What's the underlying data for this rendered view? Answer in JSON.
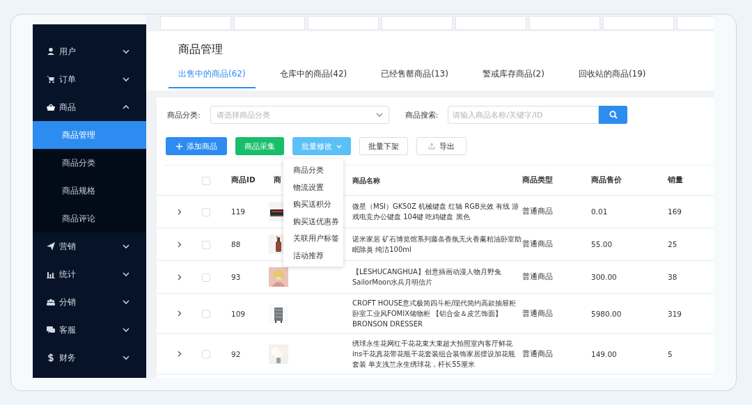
{
  "sidebar": {
    "items": [
      {
        "label": "用户",
        "expanded": false
      },
      {
        "label": "订单",
        "expanded": false
      },
      {
        "label": "商品",
        "expanded": true,
        "children": [
          {
            "label": "商品管理",
            "selected": true
          },
          {
            "label": "商品分类",
            "selected": false
          },
          {
            "label": "商品规格",
            "selected": false
          },
          {
            "label": "商品评论",
            "selected": false
          }
        ]
      },
      {
        "label": "营销",
        "expanded": false
      },
      {
        "label": "统计",
        "expanded": false
      },
      {
        "label": "分销",
        "expanded": false
      },
      {
        "label": "客服",
        "expanded": false
      },
      {
        "label": "财务",
        "expanded": false
      }
    ]
  },
  "page": {
    "title": "商品管理"
  },
  "tabs": [
    {
      "label": "出售中的商品(62)",
      "selected": true
    },
    {
      "label": "仓库中的商品(42)",
      "selected": false
    },
    {
      "label": "已经售罄商品(13)",
      "selected": false
    },
    {
      "label": "警戒库存商品(2)",
      "selected": false
    },
    {
      "label": "回收站的商品(19)",
      "selected": false
    }
  ],
  "filters": {
    "category": {
      "label": "商品分类:",
      "placeholder": "请选择商品分类"
    },
    "search": {
      "label": "商品搜索:",
      "placeholder": "请输入商品名称/关键字/ID"
    }
  },
  "toolbar": [
    {
      "label": "添加商品",
      "kind": "primary"
    },
    {
      "label": "商品采集",
      "kind": "success"
    },
    {
      "label": "批量修改",
      "kind": "menu",
      "expanded": true
    },
    {
      "label": "批量下架",
      "kind": "default"
    },
    {
      "label": "导出",
      "kind": "export"
    }
  ],
  "batch_menu": {
    "items": [
      "商品分类",
      "物流设置",
      "购买送积分",
      "购买送优惠券",
      "关联用户标签",
      "活动推荐"
    ]
  },
  "table": {
    "header_checked": false,
    "columns": [
      "商品ID",
      "商",
      "商品名称",
      "商品类型",
      "商品售价",
      "销量"
    ],
    "rows": [
      {
        "id": "119",
        "name": "微星（MSI）GK50Z 机械键盘 红轴 RGB光效 有线 游戏电竞办公键盘 104键 吃鸡键盘 黑色",
        "type": "普通商品",
        "price": "0.01",
        "sales": "169",
        "checked": false,
        "expanded": false
      },
      {
        "id": "88",
        "name": "诺米家居 矿石博览馆系列藤条香氛无火香薰精油卧室助眠除臭 纯洁100ml",
        "type": "普通商品",
        "price": "55.00",
        "sales": "25",
        "checked": false,
        "expanded": false
      },
      {
        "id": "93",
        "name": "【LESHUCANGHUA】创意插画动漫人物月野兔SailorMoon水兵月明信片",
        "type": "普通商品",
        "price": "300.00",
        "sales": "38",
        "checked": false,
        "expanded": false
      },
      {
        "id": "109",
        "name": "CROFT HOUSE意式极简四斗柜/现代简约高款抽屉柜卧室工业风FOMIX储物柜 【铝合金＆皮艺饰面】 BRONSON DRESSER",
        "type": "普通商品",
        "price": "5980.00",
        "sales": "319",
        "checked": false,
        "expanded": false
      },
      {
        "id": "92",
        "name": "绣球永生花网红干花花束大束超大拍照室内客厅鲜花ins干花真花带花瓶干花套装组合装饰家居摆设加花瓶套装 单支浅兰永生绣球花，杆长55厘米",
        "type": "普通商品",
        "price": "149.00",
        "sales": "5",
        "checked": false,
        "expanded": false
      }
    ]
  }
}
